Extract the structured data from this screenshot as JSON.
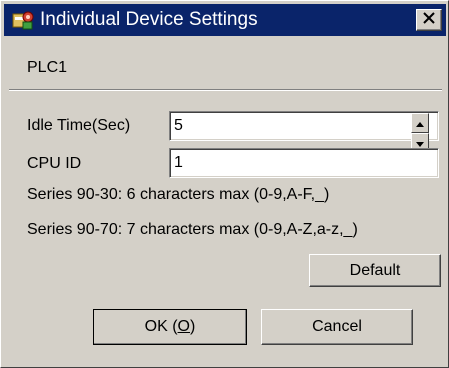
{
  "window": {
    "title": "Individual Device Settings",
    "close_symbol": "✕"
  },
  "device": {
    "name": "PLC1"
  },
  "form": {
    "idle_time_label": "Idle Time(Sec)",
    "idle_time_value": "5",
    "cpu_id_label": "CPU ID",
    "cpu_id_value": "1",
    "note_series_90_30": "Series 90-30: 6 characters max (0-9,A-F,_)",
    "note_series_90_70": "Series 90-70: 7 characters max (0-9,A-Z,a-z,_)"
  },
  "buttons": {
    "default_label": "Default",
    "ok_label_prefix": "OK (",
    "ok_hotkey": "O",
    "ok_label_suffix": ")",
    "cancel_label": "Cancel"
  },
  "icons": {
    "title_icon": "device-settings-icon",
    "close_icon": "close-icon",
    "spin_up_icon": "spin-up-icon",
    "spin_down_icon": "spin-down-icon"
  },
  "colors": {
    "titlebar": "#0a246a",
    "dialog_face": "#d4d0c8"
  }
}
